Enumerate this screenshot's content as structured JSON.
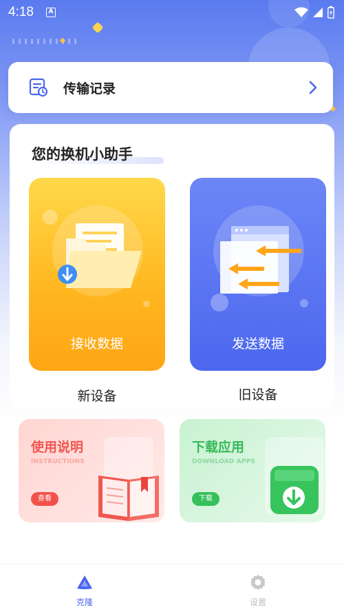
{
  "status_bar": {
    "time": "4:18",
    "notification_badge": "A"
  },
  "record": {
    "title": "传输记录",
    "icon": "document-list-icon",
    "arrow_icon": "chevron-right-icon"
  },
  "helper": {
    "title": "您的换机小助手",
    "new_device": {
      "card_label": "接收数据",
      "caption": "新设备",
      "icon": "folder-download-icon"
    },
    "old_device": {
      "card_label": "发送数据",
      "caption": "旧设备",
      "icon": "window-send-icon"
    }
  },
  "features": {
    "instructions": {
      "title": "使用说明",
      "subtitle": "INSTRUCTIONS",
      "button": "查看",
      "icon": "book-icon"
    },
    "download": {
      "title": "下载应用",
      "subtitle": "DOWNLOAD APPS",
      "button": "下载",
      "icon": "download-box-icon"
    }
  },
  "nav": {
    "clone": {
      "label": "克隆",
      "icon": "triangle-logo-icon",
      "active": true
    },
    "settings": {
      "label": "设置",
      "icon": "gear-icon",
      "active": false
    }
  },
  "colors": {
    "primary": "#4b66ee",
    "new_card": "#ffb61e",
    "old_card": "#4c67ee",
    "instructions_accent": "#f1564f",
    "download_accent": "#35b957"
  }
}
